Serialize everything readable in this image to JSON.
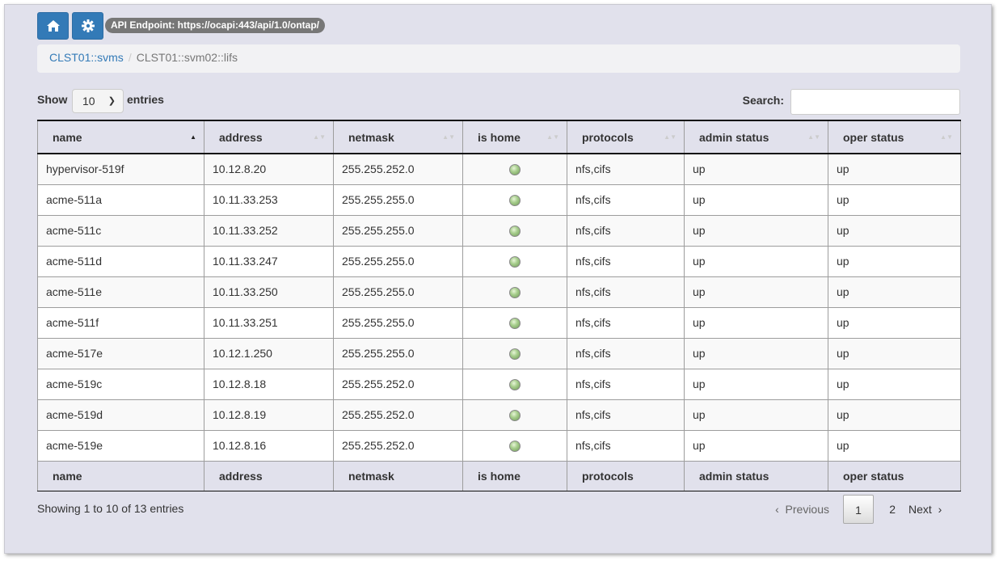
{
  "header": {
    "home_icon": "home-icon",
    "settings_icon": "gear-icon",
    "endpoint_label": "API Endpoint: https://ocapi:443/api/1.0/ontap/"
  },
  "breadcrumb": {
    "parent": "CLST01::svms",
    "current": "CLST01::svm02::lifs"
  },
  "controls": {
    "show_label": "Show",
    "length_value": "10",
    "entries_label": "entries",
    "search_label": "Search:",
    "search_value": ""
  },
  "table": {
    "columns": [
      "name",
      "address",
      "netmask",
      "is home",
      "protocols",
      "admin status",
      "oper status"
    ],
    "sorted_column": "name",
    "sort_direction": "ascending",
    "rows": [
      [
        "hypervisor-519f",
        "10.12.8.20",
        "255.255.252.0",
        true,
        "nfs,cifs",
        "up",
        "up"
      ],
      [
        "acme-511a",
        "10.11.33.253",
        "255.255.255.0",
        true,
        "nfs,cifs",
        "up",
        "up"
      ],
      [
        "acme-511c",
        "10.11.33.252",
        "255.255.255.0",
        true,
        "nfs,cifs",
        "up",
        "up"
      ],
      [
        "acme-511d",
        "10.11.33.247",
        "255.255.255.0",
        true,
        "nfs,cifs",
        "up",
        "up"
      ],
      [
        "acme-511e",
        "10.11.33.250",
        "255.255.255.0",
        true,
        "nfs,cifs",
        "up",
        "up"
      ],
      [
        "acme-511f",
        "10.11.33.251",
        "255.255.255.0",
        true,
        "nfs,cifs",
        "up",
        "up"
      ],
      [
        "acme-517e",
        "10.12.1.250",
        "255.255.255.0",
        true,
        "nfs,cifs",
        "up",
        "up"
      ],
      [
        "acme-519c",
        "10.12.8.18",
        "255.255.252.0",
        true,
        "nfs,cifs",
        "up",
        "up"
      ],
      [
        "acme-519d",
        "10.12.8.19",
        "255.255.252.0",
        true,
        "nfs,cifs",
        "up",
        "up"
      ],
      [
        "acme-519e",
        "10.12.8.16",
        "255.255.252.0",
        true,
        "nfs,cifs",
        "up",
        "up"
      ]
    ]
  },
  "footer": {
    "info": "Showing 1 to 10 of 13 entries",
    "previous": "Previous",
    "next": "Next",
    "pages": [
      "1",
      "2"
    ],
    "current_page": "1"
  },
  "colors": {
    "accent": "#337ab7",
    "background": "#e1e1ec",
    "status_green": "#a9cf8f"
  }
}
